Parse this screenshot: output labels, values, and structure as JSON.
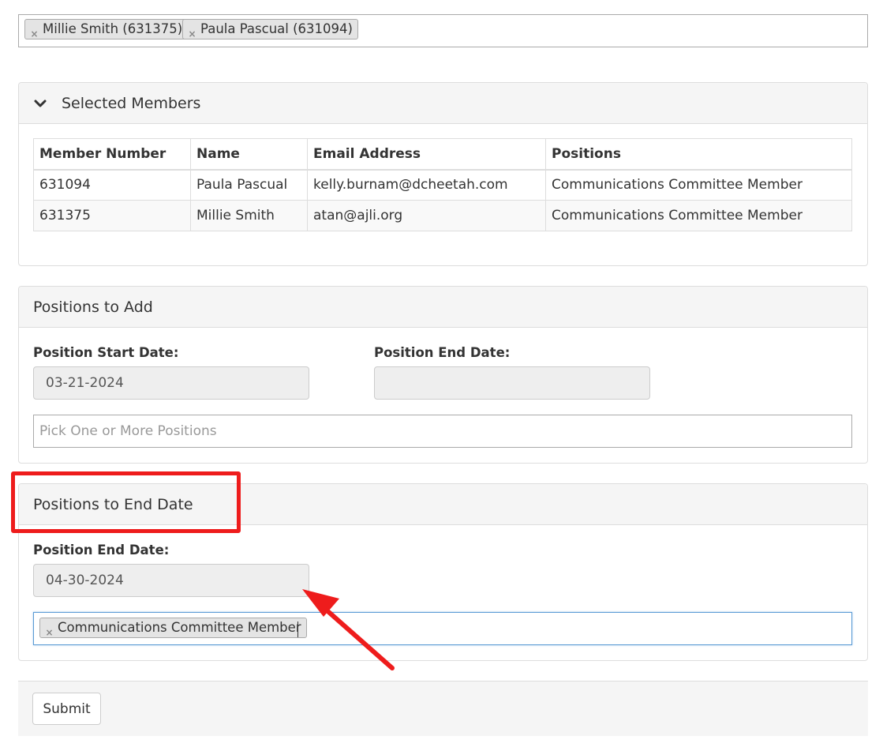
{
  "member_select": {
    "chips": [
      {
        "label": "Millie Smith (631375)",
        "remove_glyph": "×"
      },
      {
        "label": "Paula Pascual (631094)",
        "remove_glyph": "×"
      }
    ]
  },
  "selected_members": {
    "title": "Selected Members",
    "columns": [
      "Member Number",
      "Name",
      "Email Address",
      "Positions"
    ],
    "rows": [
      [
        "631094",
        "Paula Pascual",
        "kelly.burnam@dcheetah.com",
        "Communications Committee Member"
      ],
      [
        "631375",
        "Millie Smith",
        "atan@ajli.org",
        "Communications Committee Member"
      ]
    ]
  },
  "positions_to_add": {
    "title": "Positions to Add",
    "start_label": "Position Start Date:",
    "start_value": "03-21-2024",
    "end_label": "Position End Date:",
    "end_value": "",
    "positions_placeholder": "Pick One or More Positions"
  },
  "positions_to_end": {
    "title": "Positions to End Date",
    "end_label": "Position End Date:",
    "end_value": "04-30-2024",
    "chip_label": "Communications Committee Member",
    "chip_remove_glyph": "×"
  },
  "footer": {
    "submit_label": "Submit"
  },
  "annotation": {
    "color": "#ee1c1c"
  }
}
